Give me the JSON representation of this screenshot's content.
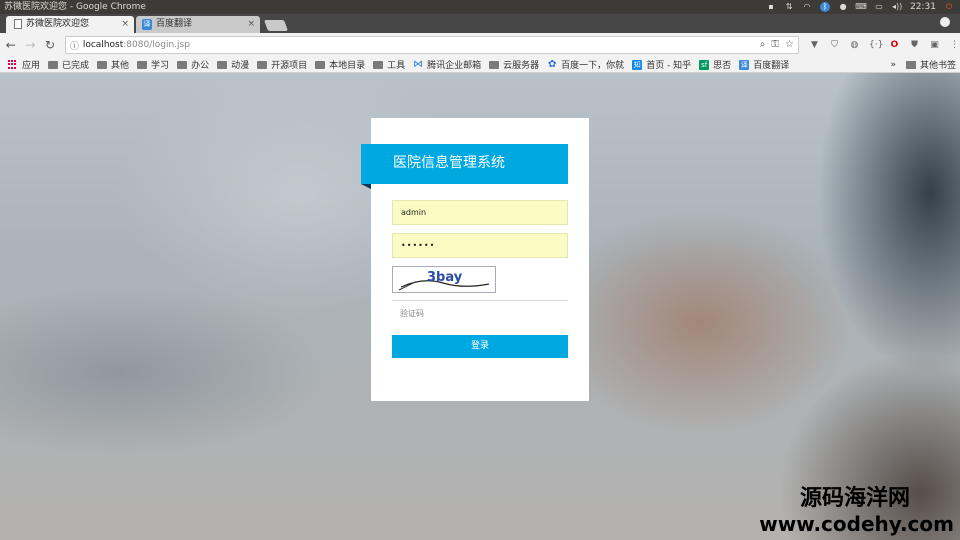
{
  "window": {
    "title": "苏微医院欢迎您 - Google Chrome",
    "time": "22:31"
  },
  "tabs": [
    {
      "title": "苏微医院欢迎您",
      "favicon": "document-icon"
    },
    {
      "title": "百度翻译",
      "favicon": "baidu-translate-icon"
    }
  ],
  "address": {
    "host": "localhost",
    "path": ":8080/login.jsp"
  },
  "bookmarks": {
    "apps": "应用",
    "items": [
      {
        "label": "已完成",
        "icon": "folder-icon"
      },
      {
        "label": "其他",
        "icon": "folder-icon"
      },
      {
        "label": "学习",
        "icon": "folder-icon"
      },
      {
        "label": "办公",
        "icon": "folder-icon"
      },
      {
        "label": "动漫",
        "icon": "folder-icon"
      },
      {
        "label": "开源项目",
        "icon": "folder-icon"
      },
      {
        "label": "本地目录",
        "icon": "folder-icon"
      },
      {
        "label": "工具",
        "icon": "folder-icon"
      },
      {
        "label": "腾讯企业邮箱",
        "icon": "tencent-mail-icon"
      },
      {
        "label": "云服务器",
        "icon": "folder-icon"
      },
      {
        "label": "百度一下，你就",
        "icon": "baidu-paw-icon"
      },
      {
        "label": "首页 - 知乎",
        "icon": "zhihu-icon"
      },
      {
        "label": "思否",
        "icon": "segmentfault-icon"
      },
      {
        "label": "百度翻译",
        "icon": "baidu-translate-icon"
      }
    ],
    "more": "»",
    "other": "其他书签"
  },
  "login": {
    "system_title": "医院信息管理系统",
    "username_value": "admin",
    "password_mask": "••••••",
    "captcha_text": "3bay",
    "code_placeholder": "验证码",
    "submit_label": "登录"
  },
  "watermark": {
    "line1": "源码海洋网",
    "line2": "www.codehy.com"
  },
  "colors": {
    "accent": "#00a8e1",
    "input_fill": "#fbfbc3"
  }
}
